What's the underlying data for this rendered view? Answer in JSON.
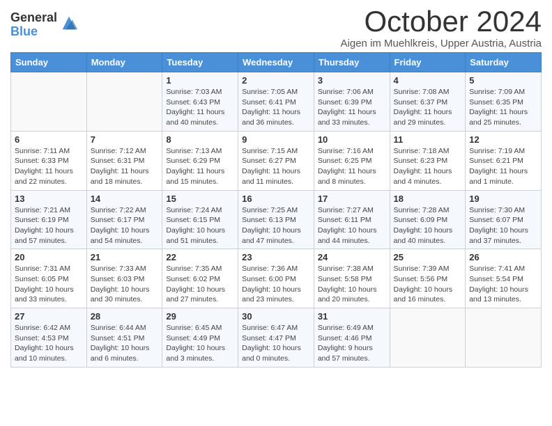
{
  "logo": {
    "general": "General",
    "blue": "Blue"
  },
  "title": "October 2024",
  "location": "Aigen im Muehlkreis, Upper Austria, Austria",
  "days_of_week": [
    "Sunday",
    "Monday",
    "Tuesday",
    "Wednesday",
    "Thursday",
    "Friday",
    "Saturday"
  ],
  "weeks": [
    [
      {
        "day": "",
        "info": ""
      },
      {
        "day": "",
        "info": ""
      },
      {
        "day": "1",
        "info": "Sunrise: 7:03 AM\nSunset: 6:43 PM\nDaylight: 11 hours and 40 minutes."
      },
      {
        "day": "2",
        "info": "Sunrise: 7:05 AM\nSunset: 6:41 PM\nDaylight: 11 hours and 36 minutes."
      },
      {
        "day": "3",
        "info": "Sunrise: 7:06 AM\nSunset: 6:39 PM\nDaylight: 11 hours and 33 minutes."
      },
      {
        "day": "4",
        "info": "Sunrise: 7:08 AM\nSunset: 6:37 PM\nDaylight: 11 hours and 29 minutes."
      },
      {
        "day": "5",
        "info": "Sunrise: 7:09 AM\nSunset: 6:35 PM\nDaylight: 11 hours and 25 minutes."
      }
    ],
    [
      {
        "day": "6",
        "info": "Sunrise: 7:11 AM\nSunset: 6:33 PM\nDaylight: 11 hours and 22 minutes."
      },
      {
        "day": "7",
        "info": "Sunrise: 7:12 AM\nSunset: 6:31 PM\nDaylight: 11 hours and 18 minutes."
      },
      {
        "day": "8",
        "info": "Sunrise: 7:13 AM\nSunset: 6:29 PM\nDaylight: 11 hours and 15 minutes."
      },
      {
        "day": "9",
        "info": "Sunrise: 7:15 AM\nSunset: 6:27 PM\nDaylight: 11 hours and 11 minutes."
      },
      {
        "day": "10",
        "info": "Sunrise: 7:16 AM\nSunset: 6:25 PM\nDaylight: 11 hours and 8 minutes."
      },
      {
        "day": "11",
        "info": "Sunrise: 7:18 AM\nSunset: 6:23 PM\nDaylight: 11 hours and 4 minutes."
      },
      {
        "day": "12",
        "info": "Sunrise: 7:19 AM\nSunset: 6:21 PM\nDaylight: 11 hours and 1 minute."
      }
    ],
    [
      {
        "day": "13",
        "info": "Sunrise: 7:21 AM\nSunset: 6:19 PM\nDaylight: 10 hours and 57 minutes."
      },
      {
        "day": "14",
        "info": "Sunrise: 7:22 AM\nSunset: 6:17 PM\nDaylight: 10 hours and 54 minutes."
      },
      {
        "day": "15",
        "info": "Sunrise: 7:24 AM\nSunset: 6:15 PM\nDaylight: 10 hours and 51 minutes."
      },
      {
        "day": "16",
        "info": "Sunrise: 7:25 AM\nSunset: 6:13 PM\nDaylight: 10 hours and 47 minutes."
      },
      {
        "day": "17",
        "info": "Sunrise: 7:27 AM\nSunset: 6:11 PM\nDaylight: 10 hours and 44 minutes."
      },
      {
        "day": "18",
        "info": "Sunrise: 7:28 AM\nSunset: 6:09 PM\nDaylight: 10 hours and 40 minutes."
      },
      {
        "day": "19",
        "info": "Sunrise: 7:30 AM\nSunset: 6:07 PM\nDaylight: 10 hours and 37 minutes."
      }
    ],
    [
      {
        "day": "20",
        "info": "Sunrise: 7:31 AM\nSunset: 6:05 PM\nDaylight: 10 hours and 33 minutes."
      },
      {
        "day": "21",
        "info": "Sunrise: 7:33 AM\nSunset: 6:03 PM\nDaylight: 10 hours and 30 minutes."
      },
      {
        "day": "22",
        "info": "Sunrise: 7:35 AM\nSunset: 6:02 PM\nDaylight: 10 hours and 27 minutes."
      },
      {
        "day": "23",
        "info": "Sunrise: 7:36 AM\nSunset: 6:00 PM\nDaylight: 10 hours and 23 minutes."
      },
      {
        "day": "24",
        "info": "Sunrise: 7:38 AM\nSunset: 5:58 PM\nDaylight: 10 hours and 20 minutes."
      },
      {
        "day": "25",
        "info": "Sunrise: 7:39 AM\nSunset: 5:56 PM\nDaylight: 10 hours and 16 minutes."
      },
      {
        "day": "26",
        "info": "Sunrise: 7:41 AM\nSunset: 5:54 PM\nDaylight: 10 hours and 13 minutes."
      }
    ],
    [
      {
        "day": "27",
        "info": "Sunrise: 6:42 AM\nSunset: 4:53 PM\nDaylight: 10 hours and 10 minutes."
      },
      {
        "day": "28",
        "info": "Sunrise: 6:44 AM\nSunset: 4:51 PM\nDaylight: 10 hours and 6 minutes."
      },
      {
        "day": "29",
        "info": "Sunrise: 6:45 AM\nSunset: 4:49 PM\nDaylight: 10 hours and 3 minutes."
      },
      {
        "day": "30",
        "info": "Sunrise: 6:47 AM\nSunset: 4:47 PM\nDaylight: 10 hours and 0 minutes."
      },
      {
        "day": "31",
        "info": "Sunrise: 6:49 AM\nSunset: 4:46 PM\nDaylight: 9 hours and 57 minutes."
      },
      {
        "day": "",
        "info": ""
      },
      {
        "day": "",
        "info": ""
      }
    ]
  ]
}
